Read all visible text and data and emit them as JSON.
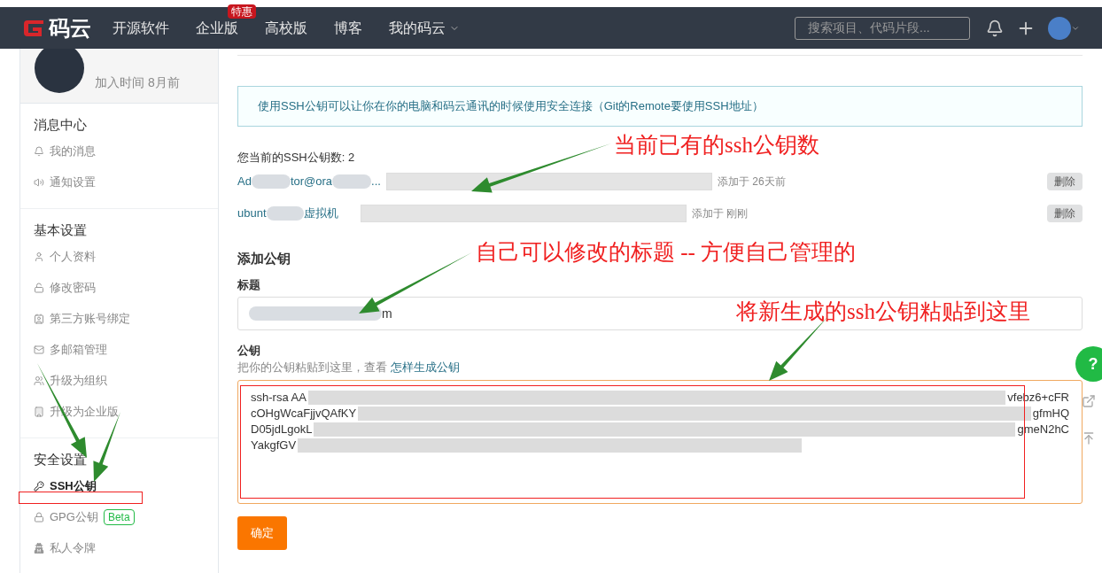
{
  "navbar": {
    "logo_text": "码云",
    "links": [
      {
        "label": "开源软件"
      },
      {
        "label": "企业版",
        "badge": "特惠"
      },
      {
        "label": "高校版"
      },
      {
        "label": "博客"
      },
      {
        "label": "我的码云",
        "dropdown": true
      }
    ],
    "search": {
      "placeholder": "搜索项目、代码片段..."
    }
  },
  "sidebar": {
    "profile": {
      "joined": "加入时间 8月前"
    },
    "sections": [
      {
        "title": "消息中心",
        "items": [
          {
            "label": "我的消息",
            "selected": false
          },
          {
            "label": "通知设置",
            "selected": false
          }
        ]
      },
      {
        "title": "基本设置",
        "items": [
          {
            "label": "个人资料",
            "selected": false
          },
          {
            "label": "修改密码",
            "selected": false
          },
          {
            "label": "第三方账号绑定",
            "selected": false
          },
          {
            "label": "多邮箱管理",
            "selected": false
          },
          {
            "label": "升级为组织",
            "selected": false
          },
          {
            "label": "升级为企业版",
            "selected": false
          }
        ]
      },
      {
        "title": "安全设置",
        "items": [
          {
            "label": "SSH公钥",
            "selected": true
          },
          {
            "label": "GPG公钥",
            "selected": false,
            "badge": "Beta"
          },
          {
            "label": "私人令牌",
            "selected": false
          }
        ]
      }
    ]
  },
  "main": {
    "notice": "使用SSH公钥可以让你在你的电脑和码云通讯的时候使用安全连接（Git的Remote要使用SSH地址）",
    "count": "您当前的SSH公钥数: 2",
    "keys": [
      {
        "title_fragments": [
          "Ad",
          "tor@ora",
          "..."
        ],
        "added": "添加于 26天前",
        "delete": "删除"
      },
      {
        "title_fragments": [
          "ubunt",
          "虚拟机"
        ],
        "added": "添加于 刚刚",
        "delete": "删除"
      }
    ],
    "form": {
      "heading": "添加公钥",
      "title_label": "标题",
      "title_value": "m",
      "key_label": "公钥",
      "hint": "把你的公钥粘贴到这里，查看",
      "hint_link": "怎样生成公钥",
      "key_lines": [
        {
          "left": "ssh-rsa AA",
          "right": "vfebz6+cFR"
        },
        {
          "left": "cOHgWcaFjjvQAfKY",
          "right": "gfmHQ"
        },
        {
          "left": "D05jdLgokL",
          "right": "gmeN2hC"
        },
        {
          "left": "YakgfGV"
        }
      ],
      "submit": "确定"
    }
  },
  "float_buttons": {
    "help": "?"
  },
  "annotations": [
    "当前已有的ssh公钥数",
    "自己可以修改的标题 -- 方便自己管理的",
    "将新生成的ssh公钥粘贴到这里"
  ]
}
